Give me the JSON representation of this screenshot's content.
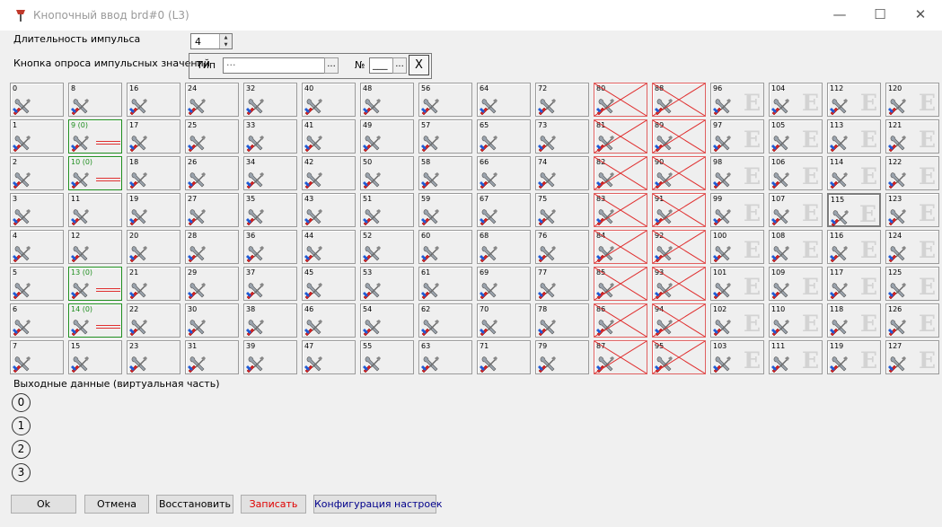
{
  "window": {
    "title": "Кнопочный ввод brd#0 (L3)",
    "controls": {
      "minimize": "—",
      "maximize": "☐",
      "close": "✕"
    }
  },
  "pulse": {
    "label": "Длительность импульса",
    "value": "4"
  },
  "poll_button": {
    "label": "Кнопка опроса импульсных значений",
    "type_label": "Тип",
    "type_value": "···",
    "number_label": "№",
    "number_value": "___",
    "ellipsis": "...",
    "clear": "X"
  },
  "grid": {
    "cells": [
      {
        "label": "0",
        "state": "normal"
      },
      {
        "label": "1",
        "state": "normal"
      },
      {
        "label": "2",
        "state": "normal"
      },
      {
        "label": "3",
        "state": "normal"
      },
      {
        "label": "4",
        "state": "normal"
      },
      {
        "label": "5",
        "state": "normal"
      },
      {
        "label": "6",
        "state": "normal"
      },
      {
        "label": "7",
        "state": "normal"
      },
      {
        "label": "8",
        "state": "normal"
      },
      {
        "label": "9 (0)",
        "state": "green"
      },
      {
        "label": "10 (0)",
        "state": "green"
      },
      {
        "label": "11",
        "state": "normal"
      },
      {
        "label": "12",
        "state": "normal"
      },
      {
        "label": "13 (0)",
        "state": "green"
      },
      {
        "label": "14 (0)",
        "state": "green"
      },
      {
        "label": "15",
        "state": "normal"
      },
      {
        "label": "16",
        "state": "normal"
      },
      {
        "label": "17",
        "state": "normal"
      },
      {
        "label": "18",
        "state": "normal"
      },
      {
        "label": "19",
        "state": "normal"
      },
      {
        "label": "20",
        "state": "normal"
      },
      {
        "label": "21",
        "state": "normal"
      },
      {
        "label": "22",
        "state": "normal"
      },
      {
        "label": "23",
        "state": "normal"
      },
      {
        "label": "24",
        "state": "normal"
      },
      {
        "label": "25",
        "state": "normal"
      },
      {
        "label": "26",
        "state": "normal"
      },
      {
        "label": "27",
        "state": "normal"
      },
      {
        "label": "28",
        "state": "normal"
      },
      {
        "label": "29",
        "state": "normal"
      },
      {
        "label": "30",
        "state": "normal"
      },
      {
        "label": "31",
        "state": "normal"
      },
      {
        "label": "32",
        "state": "normal"
      },
      {
        "label": "33",
        "state": "normal"
      },
      {
        "label": "34",
        "state": "normal"
      },
      {
        "label": "35",
        "state": "normal"
      },
      {
        "label": "36",
        "state": "normal"
      },
      {
        "label": "37",
        "state": "normal"
      },
      {
        "label": "38",
        "state": "normal"
      },
      {
        "label": "39",
        "state": "normal"
      },
      {
        "label": "40",
        "state": "normal"
      },
      {
        "label": "41",
        "state": "normal"
      },
      {
        "label": "42",
        "state": "normal"
      },
      {
        "label": "43",
        "state": "normal"
      },
      {
        "label": "44",
        "state": "normal"
      },
      {
        "label": "45",
        "state": "normal"
      },
      {
        "label": "46",
        "state": "normal"
      },
      {
        "label": "47",
        "state": "normal"
      },
      {
        "label": "48",
        "state": "normal"
      },
      {
        "label": "49",
        "state": "normal"
      },
      {
        "label": "50",
        "state": "normal"
      },
      {
        "label": "51",
        "state": "normal"
      },
      {
        "label": "52",
        "state": "normal"
      },
      {
        "label": "53",
        "state": "normal"
      },
      {
        "label": "54",
        "state": "normal"
      },
      {
        "label": "55",
        "state": "normal"
      },
      {
        "label": "56",
        "state": "normal"
      },
      {
        "label": "57",
        "state": "normal"
      },
      {
        "label": "58",
        "state": "normal"
      },
      {
        "label": "59",
        "state": "normal"
      },
      {
        "label": "60",
        "state": "normal"
      },
      {
        "label": "61",
        "state": "normal"
      },
      {
        "label": "62",
        "state": "normal"
      },
      {
        "label": "63",
        "state": "normal"
      },
      {
        "label": "64",
        "state": "normal"
      },
      {
        "label": "65",
        "state": "normal"
      },
      {
        "label": "66",
        "state": "normal"
      },
      {
        "label": "67",
        "state": "normal"
      },
      {
        "label": "68",
        "state": "normal"
      },
      {
        "label": "69",
        "state": "normal"
      },
      {
        "label": "70",
        "state": "normal"
      },
      {
        "label": "71",
        "state": "normal"
      },
      {
        "label": "72",
        "state": "normal"
      },
      {
        "label": "73",
        "state": "normal"
      },
      {
        "label": "74",
        "state": "normal"
      },
      {
        "label": "75",
        "state": "normal"
      },
      {
        "label": "76",
        "state": "normal"
      },
      {
        "label": "77",
        "state": "normal"
      },
      {
        "label": "78",
        "state": "normal"
      },
      {
        "label": "79",
        "state": "normal"
      },
      {
        "label": "80",
        "state": "disabled"
      },
      {
        "label": "81",
        "state": "disabled"
      },
      {
        "label": "82",
        "state": "disabled"
      },
      {
        "label": "83",
        "state": "disabled"
      },
      {
        "label": "84",
        "state": "disabled"
      },
      {
        "label": "85",
        "state": "disabled"
      },
      {
        "label": "86",
        "state": "disabled"
      },
      {
        "label": "87",
        "state": "disabled"
      },
      {
        "label": "88",
        "state": "disabled"
      },
      {
        "label": "89",
        "state": "disabled"
      },
      {
        "label": "90",
        "state": "disabled"
      },
      {
        "label": "91",
        "state": "disabled"
      },
      {
        "label": "92",
        "state": "disabled"
      },
      {
        "label": "93",
        "state": "disabled"
      },
      {
        "label": "94",
        "state": "disabled"
      },
      {
        "label": "95",
        "state": "disabled"
      },
      {
        "label": "96",
        "state": "extended"
      },
      {
        "label": "97",
        "state": "extended"
      },
      {
        "label": "98",
        "state": "extended"
      },
      {
        "label": "99",
        "state": "extended"
      },
      {
        "label": "100",
        "state": "extended"
      },
      {
        "label": "101",
        "state": "extended"
      },
      {
        "label": "102",
        "state": "extended"
      },
      {
        "label": "103",
        "state": "extended"
      },
      {
        "label": "104",
        "state": "extended"
      },
      {
        "label": "105",
        "state": "extended"
      },
      {
        "label": "106",
        "state": "extended"
      },
      {
        "label": "107",
        "state": "extended"
      },
      {
        "label": "108",
        "state": "extended"
      },
      {
        "label": "109",
        "state": "extended"
      },
      {
        "label": "110",
        "state": "extended"
      },
      {
        "label": "111",
        "state": "extended"
      },
      {
        "label": "112",
        "state": "extended"
      },
      {
        "label": "113",
        "state": "extended"
      },
      {
        "label": "114",
        "state": "extended"
      },
      {
        "label": "115",
        "state": "extended-hover"
      },
      {
        "label": "116",
        "state": "extended"
      },
      {
        "label": "117",
        "state": "extended"
      },
      {
        "label": "118",
        "state": "extended"
      },
      {
        "label": "119",
        "state": "extended"
      },
      {
        "label": "120",
        "state": "extended"
      },
      {
        "label": "121",
        "state": "extended"
      },
      {
        "label": "122",
        "state": "extended"
      },
      {
        "label": "123",
        "state": "extended"
      },
      {
        "label": "124",
        "state": "extended"
      },
      {
        "label": "125",
        "state": "extended"
      },
      {
        "label": "126",
        "state": "extended"
      },
      {
        "label": "127",
        "state": "extended"
      }
    ],
    "extended_glyph": "E",
    "icon": "tools-icon"
  },
  "output": {
    "label": "Выходные данные (виртуальная часть)",
    "items": [
      "0",
      "1",
      "2",
      "3"
    ]
  },
  "buttons": {
    "ok": "Ok",
    "cancel": "Отмена",
    "restore": "Восстановить",
    "write": "Записать",
    "config": "Конфигурация настроек"
  },
  "colors": {
    "write_text": "#e00000",
    "config_text": "#00008b",
    "green_cell": "#1f8e1f",
    "red_cross": "#e03030"
  }
}
